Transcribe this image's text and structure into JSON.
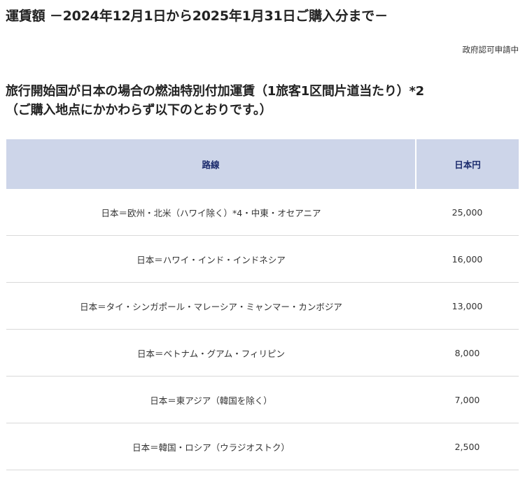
{
  "page": {
    "title": "運賃額 －2024年12月1日から2025年1月31日ご購入分まで－",
    "approval_note": "政府認可申請中"
  },
  "section": {
    "heading_line1": "旅行開始国が日本の場合の燃油特別付加運賃（1旅客1区間片道当たり）*2",
    "heading_line2": "（ご購入地点にかかわらず以下のとおりです。）"
  },
  "table": {
    "headers": {
      "route": "路線",
      "price": "日本円"
    },
    "rows": [
      {
        "route": "日本＝欧州・北米（ハワイ除く）*4・中東・オセアニア",
        "price": "25,000"
      },
      {
        "route": "日本＝ハワイ・インド・インドネシア",
        "price": "16,000"
      },
      {
        "route": "日本＝タイ・シンガポール・マレーシア・ミャンマー・カンボジア",
        "price": "13,000"
      },
      {
        "route": "日本＝ベトナム・グアム・フィリピン",
        "price": "8,000"
      },
      {
        "route": "日本＝東アジア（韓国を除く）",
        "price": "7,000"
      },
      {
        "route": "日本＝韓国・ロシア（ウラジオストク）",
        "price": "2,500"
      }
    ]
  },
  "colors": {
    "header_background": "#cdd5e9",
    "header_text": "#1a2a6c",
    "row_divider": "#d9d9d9"
  }
}
